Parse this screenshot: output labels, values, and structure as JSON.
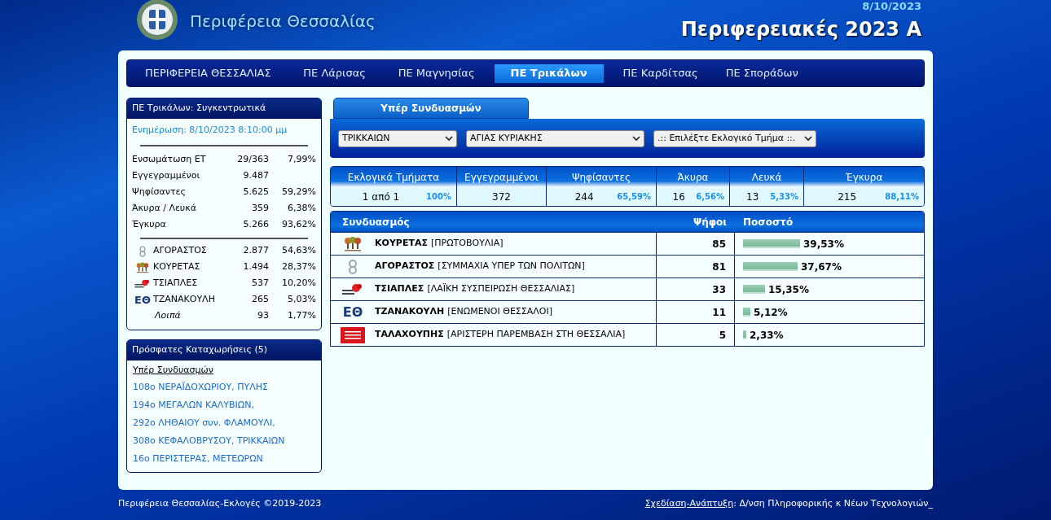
{
  "header": {
    "site_title": "Περιφέρεια Θεσσαλίας",
    "date": "8/10/2023",
    "election_title": "Περιφερειακές 2023 Α"
  },
  "nav": [
    {
      "label": "ΠΕΡΙΦΕΡΕΙΑ ΘΕΣΣΑΛΙΑΣ",
      "selected": false
    },
    {
      "label": "ΠΕ Λάρισας",
      "selected": false
    },
    {
      "label": "ΠΕ Μαγνησίας",
      "selected": false
    },
    {
      "label": "ΠΕ Τρικάλων",
      "selected": true
    },
    {
      "label": "ΠΕ Καρδίτσας",
      "selected": false
    },
    {
      "label": "ΠΕ Σποράδων",
      "selected": false
    }
  ],
  "summary": {
    "title": "ΠΕ Τρικάλων: Συγκεντρωτικά",
    "updated": "Ενημέρωση: 8/10/2023 8:10:00 μμ",
    "stats": [
      {
        "label": "Ενσωμάτωση ΕΤ",
        "value": "29/363",
        "percent": "7,99%"
      },
      {
        "label": "Εγγεγραμμένοι",
        "value": "9.487"
      },
      {
        "label": "Ψηφίσαντες",
        "value": "5.625",
        "percent": "59,29%"
      },
      {
        "label": "Άκυρα / Λευκά",
        "value": "359",
        "percent": "6,38%"
      },
      {
        "label": "Έγκυρα",
        "value": "5.266",
        "percent": "93,62%"
      }
    ],
    "parties": [
      {
        "kind": "knot",
        "name": "ΑΓΟΡΑΣΤΟΣ",
        "votes": "2.877",
        "percent": "54,63%"
      },
      {
        "kind": "trees",
        "name": "ΚΟΥΡΕΤΑΣ",
        "votes": "1.494",
        "percent": "28,37%"
      },
      {
        "kind": "flower",
        "name": "ΤΣΙΑΠΛΕΣ",
        "votes": "537",
        "percent": "10,20%"
      },
      {
        "kind": "letters",
        "logo_text": "ΕΘ",
        "name": "ΤΖΑΝΑΚΟΥΛΗ",
        "votes": "265",
        "percent": "5,03%"
      },
      {
        "kind": "other",
        "name": "Λοιπά",
        "votes": "93",
        "percent": "1,77%"
      }
    ]
  },
  "recent": {
    "title": "Πρόσφατες Καταχωρήσεις (5)",
    "heading": "Υπέρ Συνδυασμών",
    "items": [
      "108ο ΝΕΡΑΪΔΟΧΩΡΙΟΥ, ΠΥΛΗΣ",
      "194ο ΜΕΓΑΛΩΝ ΚΑΛΥΒΙΩΝ,",
      "292ο ΛΗΘΑΙΟΥ συν. ΦΛΑΜΟΥΛΙ,",
      "308ο ΚΕΦΑΛΟΒΡΥΣΟΥ, ΤΡΙΚΚΑΙΩΝ",
      "16ο ΠΕΡΙΣΤΕΡΑΣ, ΜΕΤΕΩΡΩΝ"
    ]
  },
  "tab": {
    "label": "Υπέρ Συνδυασμών",
    "selected": true
  },
  "filters": [
    "ΤΡΙΚΚΑΙΩΝ",
    "ΑΓΙΑΣ ΚΥΡΙΑΚΗΣ",
    ".:: Επιλέξτε Εκλογικό Τμήμα ::."
  ],
  "totals": [
    {
      "heading": "Εκλογικά Τμήματα",
      "value": "1 από 1",
      "percent": "100%"
    },
    {
      "heading": "Εγγεγραμμένοι",
      "value": "372"
    },
    {
      "heading": "Ψηφίσαντες",
      "value": "244",
      "percent": "65,59%"
    },
    {
      "heading": "Άκυρα",
      "value": "16",
      "percent": "6,56%"
    },
    {
      "heading": "Λευκά",
      "value": "13",
      "percent": "5,33%"
    },
    {
      "heading": "Έγκυρα",
      "value": "215",
      "percent": "88,11%"
    }
  ],
  "results": {
    "columns": [
      "Συνδυασμός",
      "Ψήφοι",
      "Ποσοστό"
    ],
    "rows": [
      {
        "kind": "trees",
        "candidate": "ΚΟΥΡΕΤΑΣ",
        "party": "[ΠΡΩΤΟΒΟΥΛΙΑ]",
        "votes": "85",
        "percent": "39,53%"
      },
      {
        "kind": "knot",
        "candidate": "ΑΓΟΡΑΣΤΟΣ",
        "party": "[ΣΥΜΜΑΧΙΑ ΥΠΕΡ ΤΩΝ ΠΟΛΙΤΩΝ]",
        "votes": "81",
        "percent": "37,67%"
      },
      {
        "kind": "flower",
        "candidate": "ΤΣΙΑΠΛΕΣ",
        "party": "[ΛΑΪΚΗ ΣΥΣΠΕΙΡΩΣΗ ΘΕΣΣΑΛΙΑΣ]",
        "votes": "33",
        "percent": "15,35%"
      },
      {
        "kind": "letters",
        "logo_text": "ΕΘ",
        "candidate": "ΤΖΑΝΑΚΟΥΛΗ",
        "party": "[ΕΝΩΜΕΝΟΙ ΘΕΣΣΑΛΟΙ]",
        "votes": "11",
        "percent": "5,12%"
      },
      {
        "kind": "banner",
        "candidate": "ΤΑΛΑΧΟΥΠΗΣ",
        "party": "[ΑΡΙΣΤΕΡΗ ΠΑΡΕΜΒΑΣΗ ΣΤΗ ΘΕΣΣΑΛΙΑ]",
        "votes": "5",
        "percent": "2,33%"
      }
    ]
  },
  "footer": {
    "copyright": "Περιφέρεια Θεσσαλίας-Εκλογές ©2019-2023",
    "credit_link": "Σχεδίαση-Ανάπτυξη",
    "credit_text": ": Δ/νση Πληροφορικής κ Νέων Τεχνολογιών_"
  }
}
